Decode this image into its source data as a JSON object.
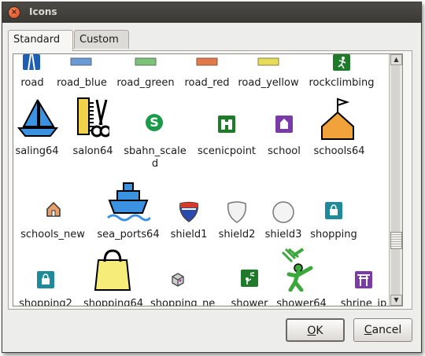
{
  "window": {
    "title": "Icons",
    "close_glyph": "×"
  },
  "tabs": [
    {
      "label": "Standard",
      "active": true
    },
    {
      "label": "Custom",
      "active": false
    }
  ],
  "icons": [
    {
      "label": "road",
      "icon": "road-icon"
    },
    {
      "label": "road_blue",
      "icon": "road-blue-icon"
    },
    {
      "label": "road_green",
      "icon": "road-green-icon"
    },
    {
      "label": "road_red",
      "icon": "road-red-icon"
    },
    {
      "label": "road_yellow",
      "icon": "road-yellow-icon"
    },
    {
      "label": "rockclimbing",
      "icon": "rockclimbing-icon"
    },
    {
      "label": "saling64",
      "icon": "sailboat-icon"
    },
    {
      "label": "salon64",
      "icon": "comb-scissors-icon"
    },
    {
      "label": "sbahn_scale",
      "label2": "d",
      "icon": "sbahn-icon",
      "glyph": "S"
    },
    {
      "label": "scenicpoint",
      "icon": "binoculars-icon"
    },
    {
      "label": "school",
      "icon": "school-icon"
    },
    {
      "label": "schools64",
      "icon": "school-flag-icon"
    },
    {
      "label": "schools_new",
      "icon": "school-house-icon"
    },
    {
      "label": "sea_ports64",
      "icon": "ship-icon"
    },
    {
      "label": "shield1",
      "icon": "interstate-shield-icon"
    },
    {
      "label": "shield2",
      "icon": "shield-icon"
    },
    {
      "label": "shield3",
      "icon": "round-shield-icon"
    },
    {
      "label": "shopping",
      "icon": "shopping-icon"
    },
    {
      "label": "shopping2",
      "icon": "shopping-bag-icon"
    },
    {
      "label": "shopping64",
      "icon": "shopping-bag-large-icon"
    },
    {
      "label": "shopping_ne",
      "icon": "shopping-box-icon"
    },
    {
      "label": "shower",
      "icon": "shower-icon"
    },
    {
      "label": "shower64",
      "icon": "shower-large-icon"
    },
    {
      "label": "shrine_jp",
      "icon": "torii-icon"
    }
  ],
  "buttons": {
    "ok": {
      "mnemonic": "O",
      "rest": "K"
    },
    "cancel": {
      "mnemonic": "C",
      "rest": "ancel"
    }
  },
  "scrollbar": {
    "up_glyph": "▲",
    "down_glyph": "▼"
  },
  "colors": {
    "road_blue": "#6a9ad6",
    "road_green": "#7ec27a",
    "road_red": "#e07a4a",
    "road_yellow": "#e6dc5a",
    "scenic_green": "#1f7a2a",
    "school_purple": "#7a3aa8",
    "teal": "#1f8a9a"
  }
}
